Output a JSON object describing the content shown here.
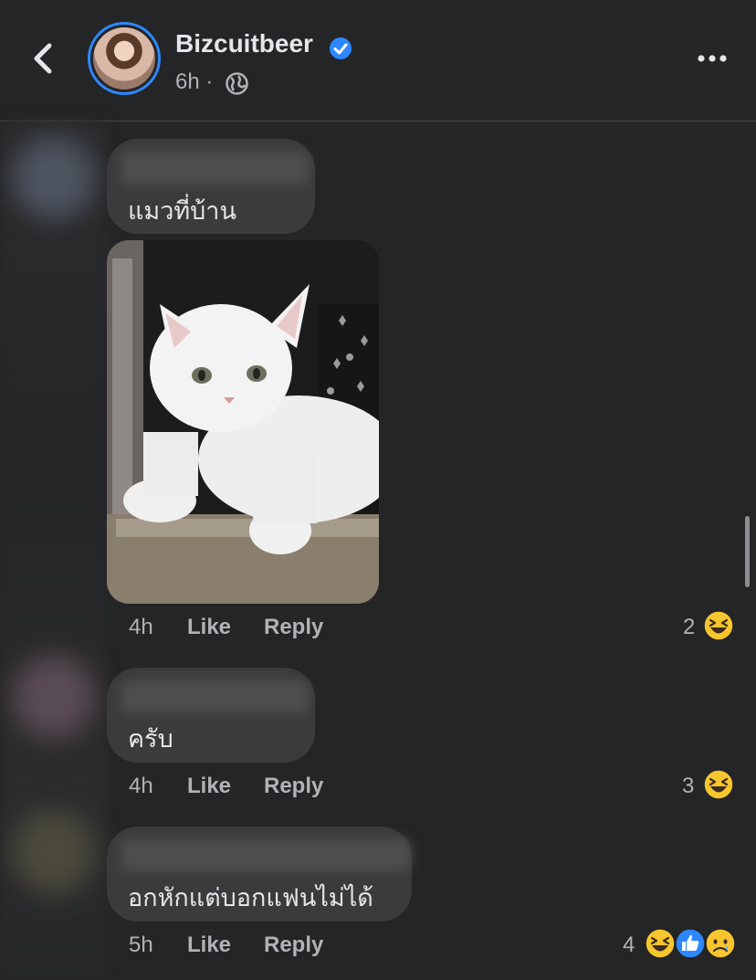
{
  "header": {
    "page_name": "Bizcuitbeer",
    "time": "6h",
    "separator": "·"
  },
  "comments": [
    {
      "text": "แมวที่บ้าน",
      "time": "4h",
      "like_label": "Like",
      "reply_label": "Reply",
      "reaction_count": "2",
      "reactions": [
        "haha-emoji"
      ]
    },
    {
      "text": "ครับ",
      "time": "4h",
      "like_label": "Like",
      "reply_label": "Reply",
      "reaction_count": "3",
      "reactions": [
        "haha-emoji"
      ]
    },
    {
      "text": "อกหักแต่บอกแฟนไม่ได้",
      "time": "5h",
      "like_label": "Like",
      "reply_label": "Reply",
      "reaction_count": "4",
      "reactions": [
        "haha-emoji",
        "like-icon",
        "sad-emoji"
      ]
    }
  ],
  "colors": {
    "background": "#242526",
    "bubble": "#3a3b3c",
    "accent": "#2d88ff",
    "secondary_text": "#b0b3b8"
  }
}
